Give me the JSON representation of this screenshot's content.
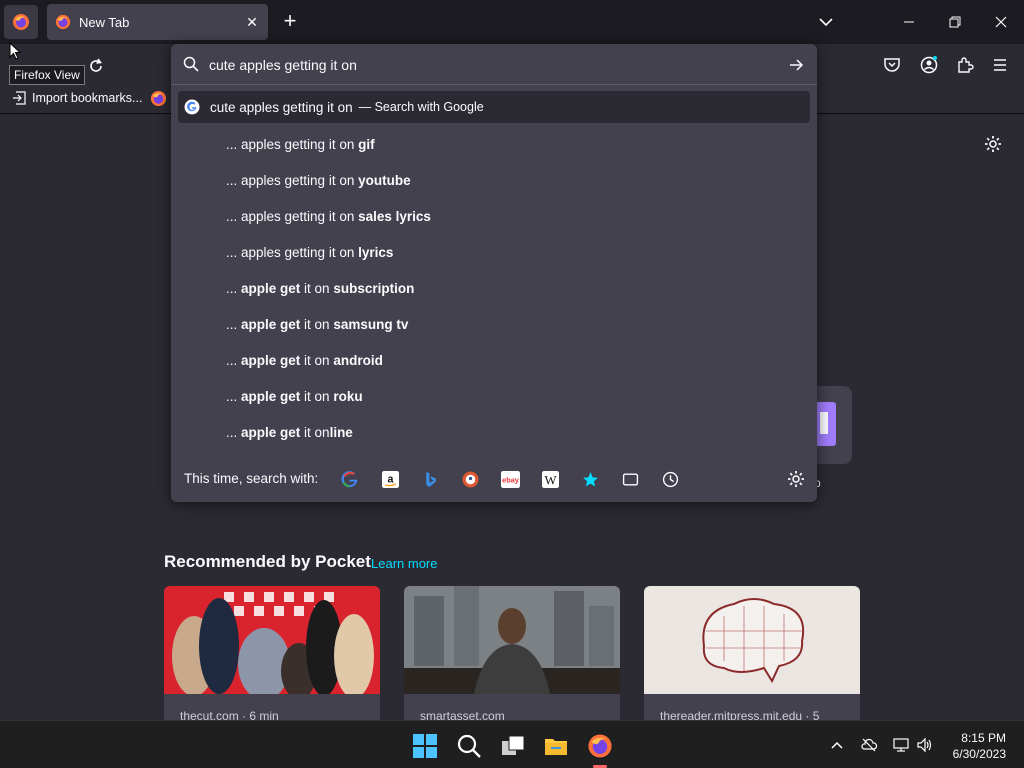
{
  "browser": {
    "tab_title": "New Tab",
    "tooltip": "Firefox View",
    "bookmarks": {
      "import_label": "Import bookmarks..."
    }
  },
  "urlbar": {
    "query": "cute apples getting it on",
    "top_result": {
      "text": "cute apples getting it on",
      "action": "— Search with Google"
    },
    "suggestions": [
      {
        "prefix": "... apples getting it on ",
        "bold": "gif",
        "rest": ""
      },
      {
        "prefix": "... apples getting it on ",
        "bold": "youtube",
        "rest": ""
      },
      {
        "prefix": "... apples getting it on ",
        "bold": "sales lyrics",
        "rest": ""
      },
      {
        "prefix": "... apples getting it on ",
        "bold": "lyrics",
        "rest": ""
      },
      {
        "prefix": "... ",
        "bold": "apple get",
        "mid": " it on ",
        "bold2": "subscription"
      },
      {
        "prefix": "... ",
        "bold": "apple get",
        "mid": " it on ",
        "bold2": "samsung tv"
      },
      {
        "prefix": "... ",
        "bold": "apple get",
        "mid": " it on ",
        "bold2": "android"
      },
      {
        "prefix": "... ",
        "bold": "apple get",
        "mid": " it on ",
        "bold2": "roku"
      },
      {
        "prefix": "... ",
        "bold": "apple get",
        "mid": " it on",
        "bold2": "line"
      }
    ],
    "oneoff_label": "This time, search with:",
    "oneoff_engines": [
      "google-icon",
      "amazon-icon",
      "bing-icon",
      "duckduckgo-icon",
      "ebay-icon",
      "wikipedia-icon",
      "bookmarks-star-icon",
      "tabs-icon",
      "history-icon"
    ]
  },
  "newtab": {
    "pocket_heading": "Recommended by Pocket",
    "pocket_learn_more": "Learn more",
    "shortcut_label_fragment": "p",
    "cards": [
      {
        "source": "thecut.com · 6 min"
      },
      {
        "source": "smartasset.com"
      },
      {
        "source": "thereader.mitpress.mit.edu · 5"
      }
    ]
  },
  "taskbar": {
    "time": "8:15 PM",
    "date": "6/30/2023"
  },
  "colors": {
    "accent": "#00ddff",
    "panel": "#42414d",
    "background": "#2b2a33",
    "toolbar": "#1c1b22"
  }
}
